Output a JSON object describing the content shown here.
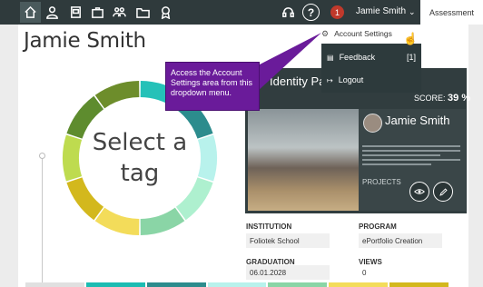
{
  "nav": {
    "icons": [
      "home-icon",
      "user-icon",
      "portfolio-icon",
      "briefcase-icon",
      "groups-icon",
      "folder-icon",
      "badge-icon",
      "support-icon",
      "help-icon"
    ],
    "help_glyph": "?",
    "notification_count": "1",
    "username": "Jamie Smith",
    "chevron": "⌄",
    "assessment_tab": "Assessment"
  },
  "profile": {
    "name": "Jamie Smith"
  },
  "tag_ring": {
    "center_line1": "Select a",
    "center_line2": "tag",
    "segment_colors": [
      "#25c1b8",
      "#2c8c8d",
      "#b8f2ec",
      "#aef0cf",
      "#8ad5a6",
      "#f3dc5a",
      "#d3b81d",
      "#bedb4f",
      "#5e8c2e",
      "#6d8d2b"
    ]
  },
  "dropdown": {
    "account_settings": "Account Settings",
    "feedback": "Feedback",
    "feedback_count": "[1]",
    "logout": "Logout"
  },
  "callout": {
    "text": "Access the Account Settings area from this dropdown menu."
  },
  "identity": {
    "title": "Identity Pa",
    "score_label": "SCORE:",
    "score_value": "39 %",
    "preview_name": "Jamie Smith",
    "preview_projects": "PROJECTS"
  },
  "info": {
    "institution_label": "INSTITUTION",
    "institution_value": "Foliotek School",
    "program_label": "PROGRAM",
    "program_value": "ePortfolio Creation",
    "graduation_label": "GRADUATION",
    "graduation_value": "06.01.2028",
    "views_label": "VIEWS",
    "views_value": "0"
  },
  "colors": {
    "nav_bg": "#2f3a3c",
    "callout": "#6a1b9a",
    "badge": "#c0392b",
    "strip": [
      "#e0e0e0",
      "#1bbcb2",
      "#2c8c8d",
      "#b8f2ec",
      "#8ad5a6",
      "#f3dc5a",
      "#d3b81d"
    ]
  }
}
